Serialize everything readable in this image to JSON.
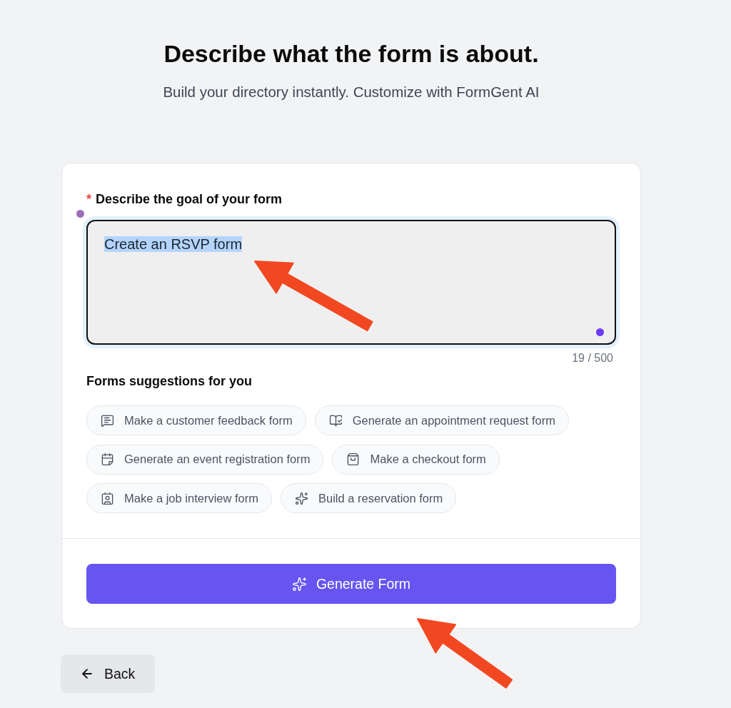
{
  "header": {
    "title": "Describe what the form is about.",
    "subtitle": "Build your directory instantly. Customize with FormGent AI"
  },
  "form": {
    "goal_field": {
      "required_mark": "*",
      "label": "Describe the goal of your form",
      "value": "Create an RSVP form",
      "value_highlighted": true,
      "counter": "19 / 500"
    },
    "suggestions_title": "Forms suggestions for you",
    "suggestions": [
      {
        "label": "Make a customer feedback form"
      },
      {
        "label": "Generate an appointment request form"
      },
      {
        "label": "Generate an event registration form"
      },
      {
        "label": "Make a checkout form"
      },
      {
        "label": "Make a job interview form"
      },
      {
        "label": "Build a reservation form"
      }
    ],
    "submit_button": "Generate Form"
  },
  "back_button": "Back"
}
